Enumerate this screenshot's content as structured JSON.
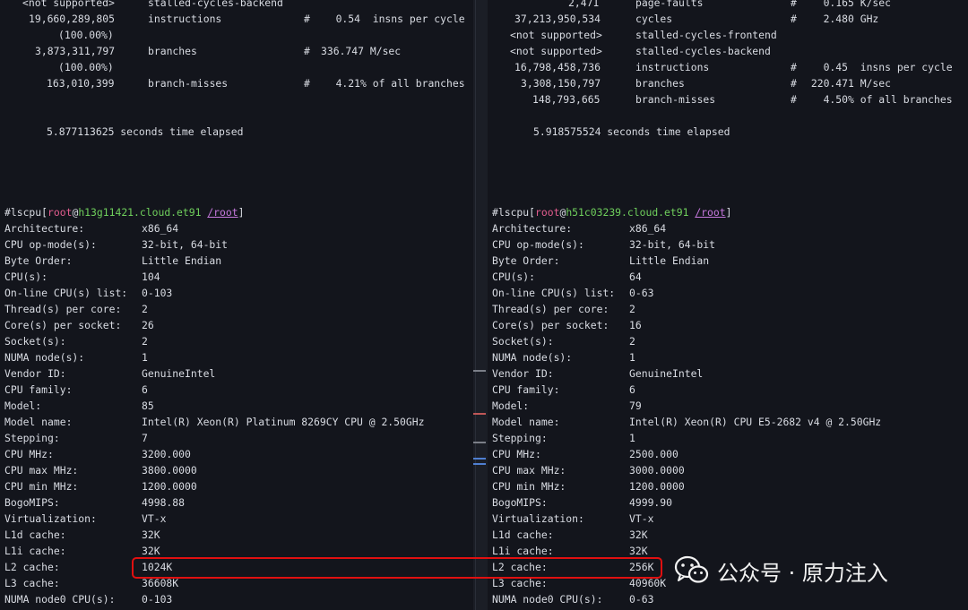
{
  "left": {
    "perf_rows": [
      {
        "value": "<not supported>",
        "event": "stalled-cycles-backend",
        "hash": "",
        "metric": ""
      },
      {
        "value": "19,660,289,805",
        "event": "instructions",
        "hash": "#",
        "metric": "   0.54  insns per cycle"
      },
      {
        "value": "(100.00%)",
        "event": "",
        "hash": "",
        "metric": ""
      },
      {
        "value": "3,873,311,797",
        "event": "branches",
        "hash": "#",
        "metric": "336.747 M/sec"
      },
      {
        "value": "(100.00%)",
        "event": "",
        "hash": "",
        "metric": ""
      },
      {
        "value": "163,010,399",
        "event": "branch-misses",
        "hash": "#",
        "metric": "   4.21% of all branches"
      }
    ],
    "elapsed": "5.877113625 seconds time elapsed",
    "prompt": {
      "user": "root",
      "host": "h13g11421.cloud.et91",
      "path": "/root"
    },
    "command": "#lscpu",
    "lscpu": [
      {
        "key": "Architecture:",
        "value": "x86_64"
      },
      {
        "key": "CPU op-mode(s):",
        "value": "32-bit, 64-bit"
      },
      {
        "key": "Byte Order:",
        "value": "Little Endian"
      },
      {
        "key": "CPU(s):",
        "value": "104"
      },
      {
        "key": "On-line CPU(s) list:",
        "value": "0-103"
      },
      {
        "key": "Thread(s) per core:",
        "value": "2"
      },
      {
        "key": "Core(s) per socket:",
        "value": "26"
      },
      {
        "key": "Socket(s):",
        "value": "2"
      },
      {
        "key": "NUMA node(s):",
        "value": "1"
      },
      {
        "key": "Vendor ID:",
        "value": "GenuineIntel"
      },
      {
        "key": "CPU family:",
        "value": "6"
      },
      {
        "key": "Model:",
        "value": "85"
      },
      {
        "key": "Model name:",
        "value": "Intel(R) Xeon(R) Platinum 8269CY CPU @ 2.50GHz"
      },
      {
        "key": "Stepping:",
        "value": "7"
      },
      {
        "key": "CPU MHz:",
        "value": "3200.000"
      },
      {
        "key": "CPU max MHz:",
        "value": "3800.0000"
      },
      {
        "key": "CPU min MHz:",
        "value": "1200.0000"
      },
      {
        "key": "BogoMIPS:",
        "value": "4998.88"
      },
      {
        "key": "Virtualization:",
        "value": "VT-x"
      },
      {
        "key": "L1d cache:",
        "value": "32K"
      },
      {
        "key": "L1i cache:",
        "value": "32K"
      },
      {
        "key": "L2 cache:",
        "value": "1024K"
      },
      {
        "key": "L3 cache:",
        "value": "36608K"
      },
      {
        "key": "NUMA node0 CPU(s):",
        "value": "0-103"
      }
    ]
  },
  "right": {
    "perf_rows": [
      {
        "value": "2,471",
        "event": "page-faults",
        "hash": "#",
        "metric": "   0.165 K/sec"
      },
      {
        "value": "37,213,950,534",
        "event": "cycles",
        "hash": "#",
        "metric": "   2.480 GHz"
      },
      {
        "value": "<not supported>",
        "event": "stalled-cycles-frontend",
        "hash": "",
        "metric": ""
      },
      {
        "value": "<not supported>",
        "event": "stalled-cycles-backend",
        "hash": "",
        "metric": ""
      },
      {
        "value": "16,798,458,736",
        "event": "instructions",
        "hash": "#",
        "metric": "   0.45  insns per cycle"
      },
      {
        "value": "3,308,150,797",
        "event": "branches",
        "hash": "#",
        "metric": " 220.471 M/sec"
      },
      {
        "value": "148,793,665",
        "event": "branch-misses",
        "hash": "#",
        "metric": "   4.50% of all branches"
      }
    ],
    "elapsed": "5.918575524 seconds time elapsed",
    "prompt": {
      "user": "root",
      "host": "h51c03239.cloud.et91",
      "path": "/root"
    },
    "command": "#lscpu",
    "lscpu": [
      {
        "key": "Architecture:",
        "value": "x86_64"
      },
      {
        "key": "CPU op-mode(s):",
        "value": "32-bit, 64-bit"
      },
      {
        "key": "Byte Order:",
        "value": "Little Endian"
      },
      {
        "key": "CPU(s):",
        "value": "64"
      },
      {
        "key": "On-line CPU(s) list:",
        "value": "0-63"
      },
      {
        "key": "Thread(s) per core:",
        "value": "2"
      },
      {
        "key": "Core(s) per socket:",
        "value": "16"
      },
      {
        "key": "Socket(s):",
        "value": "2"
      },
      {
        "key": "NUMA node(s):",
        "value": "1"
      },
      {
        "key": "Vendor ID:",
        "value": "GenuineIntel"
      },
      {
        "key": "CPU family:",
        "value": "6"
      },
      {
        "key": "Model:",
        "value": "79"
      },
      {
        "key": "Model name:",
        "value": "Intel(R) Xeon(R) CPU E5-2682 v4 @ 2.50GHz"
      },
      {
        "key": "Stepping:",
        "value": "1"
      },
      {
        "key": "CPU MHz:",
        "value": "2500.000"
      },
      {
        "key": "CPU max MHz:",
        "value": "3000.0000"
      },
      {
        "key": "CPU min MHz:",
        "value": "1200.0000"
      },
      {
        "key": "BogoMIPS:",
        "value": "4999.90"
      },
      {
        "key": "Virtualization:",
        "value": "VT-x"
      },
      {
        "key": "L1d cache:",
        "value": "32K"
      },
      {
        "key": "L1i cache:",
        "value": "32K"
      },
      {
        "key": "L2 cache:",
        "value": "256K"
      },
      {
        "key": "L3 cache:",
        "value": "40960K"
      },
      {
        "key": "NUMA node0 CPU(s):",
        "value": "0-63"
      }
    ]
  },
  "watermark": {
    "text": "公众号 · 原力注入",
    "icon": "wechat-icon"
  },
  "colors": {
    "background": "#13151c",
    "text": "#d9dce3",
    "prompt_user": "#e25c8e",
    "prompt_host": "#6fcf5c",
    "prompt_path": "#c678dd",
    "highlight": "#e01010"
  }
}
